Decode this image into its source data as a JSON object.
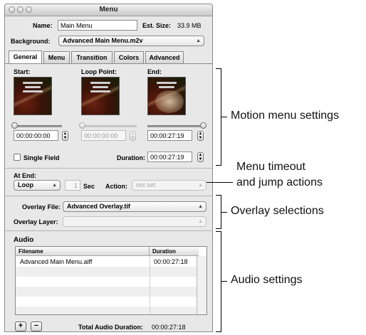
{
  "window": {
    "title": "Menu"
  },
  "top": {
    "name_label": "Name:",
    "name_value": "Main Menu",
    "est_size_label": "Est. Size:",
    "est_size_value": "33.9 MB",
    "background_label": "Background:",
    "background_value": "Advanced Main Menu.m2v"
  },
  "tabs": [
    {
      "label": "General"
    },
    {
      "label": "Menu"
    },
    {
      "label": "Transition"
    },
    {
      "label": "Colors"
    },
    {
      "label": "Advanced"
    }
  ],
  "motion": {
    "start_label": "Start:",
    "loop_label": "Loop Point:",
    "end_label": "End:",
    "start_time": "00:00:00:00",
    "loop_time": "00:00:00:00",
    "end_time": "00:00:27:19",
    "single_field_label": "Single Field",
    "duration_label": "Duration:",
    "duration_value": "00:00:27:19"
  },
  "at_end": {
    "label": "At End:",
    "action_value": "Loop",
    "timeout_value": "1",
    "sec_label": "Sec",
    "action_label": "Action:",
    "action_target": "not set"
  },
  "overlay": {
    "file_label": "Overlay File:",
    "file_value": "Advanced Overlay.tif",
    "layer_label": "Overlay Layer:",
    "layer_value": ""
  },
  "audio": {
    "title": "Audio",
    "columns": [
      "Filename",
      "Duration"
    ],
    "rows": [
      {
        "filename": "Advanced Main Menu.aiff",
        "duration": "00:00:27:18"
      }
    ],
    "add_label": "+",
    "remove_label": "−",
    "total_label": "Total Audio Duration:",
    "total_value": "00:00:27:18"
  },
  "callouts": {
    "motion": "Motion menu settings",
    "timeout_line1": "Menu timeout",
    "timeout_line2": "and jump actions",
    "overlay": "Overlay selections",
    "audio": "Audio settings"
  }
}
